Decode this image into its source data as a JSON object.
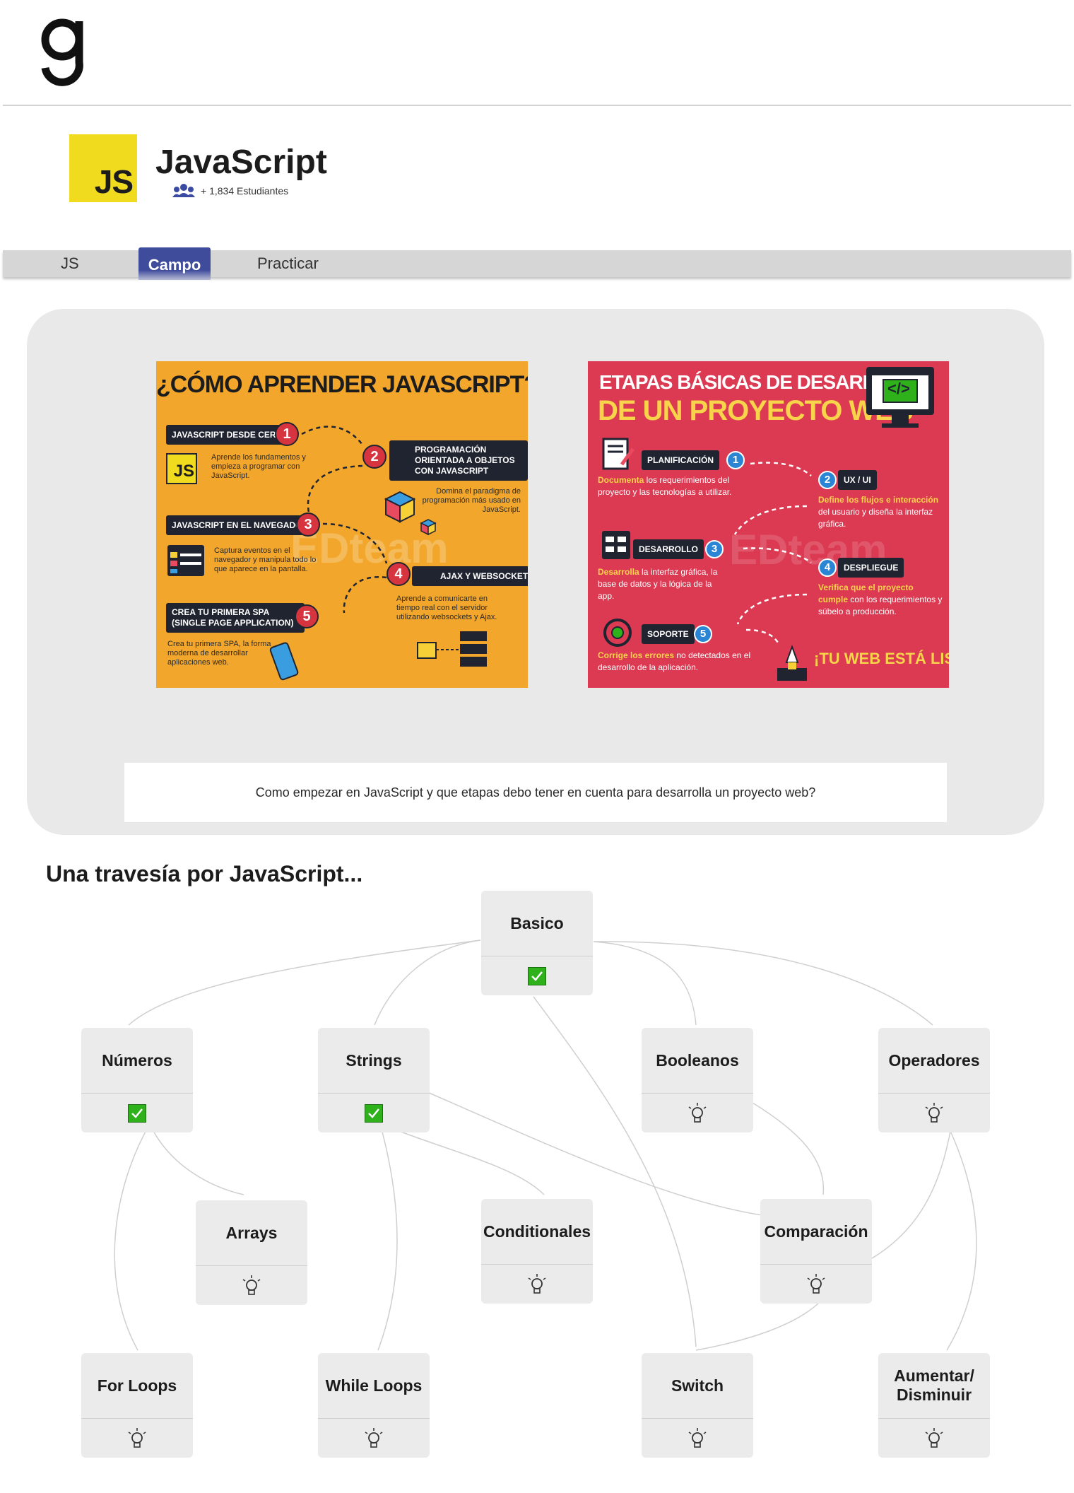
{
  "header": {
    "logo_icon": "g-logo-icon"
  },
  "course": {
    "badge": "JS",
    "title": "JavaScript",
    "students": "+ 1,834 Estudiantes",
    "students_icon": "users-icon",
    "badge_color": "#f0db1f"
  },
  "tabs": [
    {
      "label": "JS"
    },
    {
      "label": "Campo",
      "active": true
    },
    {
      "label": "Practicar"
    }
  ],
  "campo": {
    "poster1": {
      "title": "¿CÓMO APRENDER JAVASCRIPT?",
      "steps": [
        {
          "n": "1",
          "label": "JAVASCRIPT DESDE CERO",
          "text": "Aprende los fundamentos y empieza a programar con JavaScript."
        },
        {
          "n": "2",
          "label": "PROGRAMACIÓN ORIENTADA A OBJETOS CON JAVASCRIPT",
          "text": "Domina el paradigma de programación más usado en JavaScript."
        },
        {
          "n": "3",
          "label": "JAVASCRIPT EN EL NAVEGADOR",
          "text": "Captura eventos en el navegador y manipula todo lo que aparece en la pantalla."
        },
        {
          "n": "4",
          "label": "AJAX Y WEBSOCKETS",
          "text": "Aprende a comunicarte en tiempo real con el servidor utilizando websockets y Ajax."
        },
        {
          "n": "5",
          "label": "CREA TU PRIMERA SPA (SINGLE PAGE APPLICATION)",
          "text": "Crea tu primera SPA, la forma moderna de desarrollar aplicaciones web."
        }
      ],
      "mini_badge": "JS",
      "watermark": "EDteam",
      "color": "#f2a72c"
    },
    "poster2": {
      "title_line1": "ETAPAS BÁSICAS DE DESARROLLO",
      "title_line2": "DE UN PROYECTO WEB",
      "steps": [
        {
          "n": "1",
          "label": "PLANIFICACIÓN",
          "lead": "Documenta",
          "text": " los requerimientos del proyecto y las tecnologías a utilizar."
        },
        {
          "n": "2",
          "label": "UX / UI",
          "lead": "Define los flujos e interacción",
          "text": " del usuario y diseña la interfaz gráfica."
        },
        {
          "n": "3",
          "label": "DESARROLLO",
          "lead": "Desarrolla",
          "text": " la interfaz gráfica, la base de datos y la lógica de la app."
        },
        {
          "n": "4",
          "label": "DESPLIEGUE",
          "lead": "Verifica que el proyecto cumple",
          "text": " con los requerimientos y súbelo a producción."
        },
        {
          "n": "5",
          "label": "SOPORTE",
          "lead": "Corrige los errores",
          "text": " no detectados en el desarrollo de la aplicación."
        }
      ],
      "final": "¡TU WEB ESTÁ LISTA!",
      "code_glyph": "</>",
      "watermark": "EDteam",
      "color": "#db3a52"
    },
    "caption": "Como empezar en JavaScript y que etapas debo tener en cuenta para desarrolla un proyecto web?"
  },
  "journey": {
    "title": "Una travesía por JavaScript...",
    "nodes": [
      {
        "id": "basico",
        "label": "Basico",
        "status": "done"
      },
      {
        "id": "numeros",
        "label": "Números",
        "status": "done"
      },
      {
        "id": "strings",
        "label": "Strings",
        "status": "done"
      },
      {
        "id": "booleanos",
        "label": "Booleanos",
        "status": "todo"
      },
      {
        "id": "operadores",
        "label": "Operadores",
        "status": "todo"
      },
      {
        "id": "arrays",
        "label": "Arrays",
        "status": "todo"
      },
      {
        "id": "conditionales",
        "label": "Conditionales",
        "status": "todo"
      },
      {
        "id": "comparacion",
        "label": "Comparación",
        "status": "todo"
      },
      {
        "id": "forloops",
        "label": "For Loops",
        "status": "todo"
      },
      {
        "id": "whileloops",
        "label": "While Loops",
        "status": "todo"
      },
      {
        "id": "switch",
        "label": "Switch",
        "status": "todo"
      },
      {
        "id": "aumentar",
        "label": "Aumentar/ Disminuir",
        "status": "todo"
      }
    ],
    "done_icon": "check-icon",
    "todo_icon": "lightbulb-icon",
    "done_color": "#2fb11c"
  }
}
